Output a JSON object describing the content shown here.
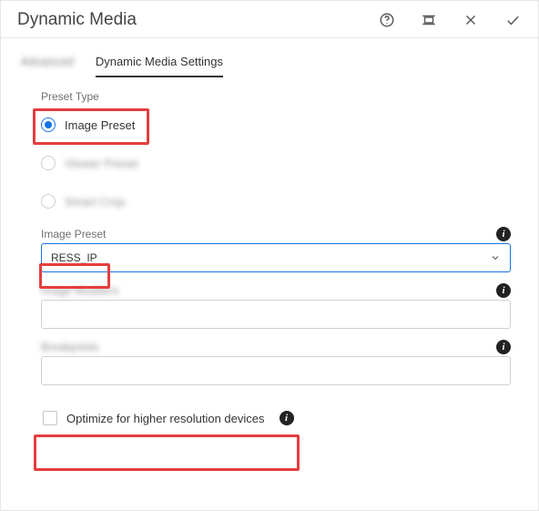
{
  "header": {
    "title": "Dynamic Media"
  },
  "tabs": {
    "advanced": "Advanced",
    "settings": "Dynamic Media Settings"
  },
  "preset_type": {
    "label": "Preset Type",
    "options": {
      "image_preset": "Image Preset",
      "viewer_preset": "Viewer Preset",
      "smart_crop": "Smart Crop"
    }
  },
  "image_preset_field": {
    "label": "Image Preset",
    "value": "RESS_IP"
  },
  "image_modifiers_field": {
    "label": "Image Modifiers",
    "value": ""
  },
  "breakpoints_field": {
    "label": "Breakpoints",
    "value": ""
  },
  "optimize": {
    "label": "Optimize for higher resolution devices"
  },
  "info_glyph": "i"
}
